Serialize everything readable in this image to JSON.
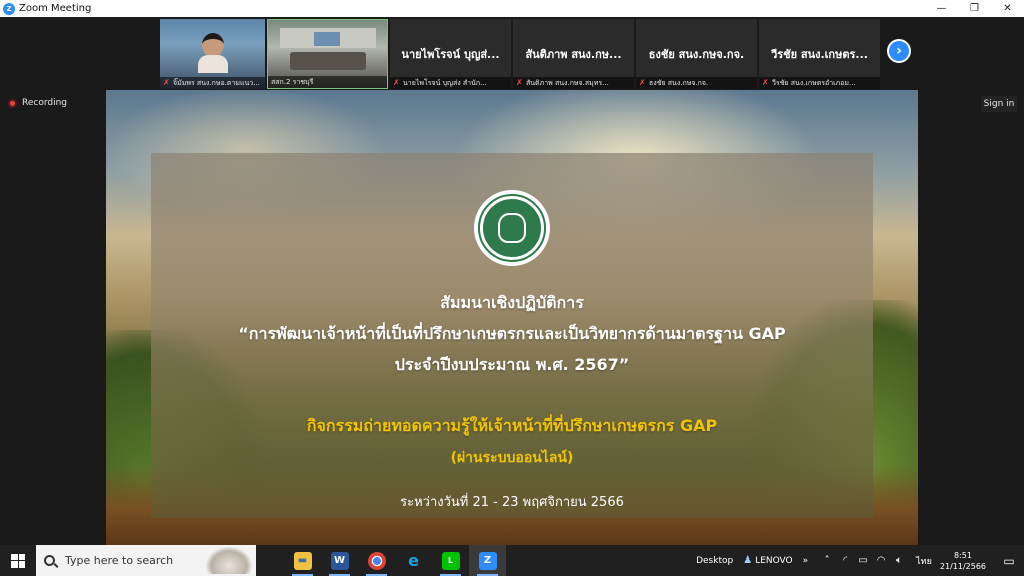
{
  "window": {
    "title": "Zoom Meeting",
    "controls": {
      "minimize": "—",
      "restore": "❐",
      "close": "✕"
    }
  },
  "participants": [
    {
      "big_name": "",
      "caption": "จิ๊มัมพร สนง.กษอ.ตามแนว..."
    },
    {
      "big_name": "",
      "caption": "สสก.2 ราชบุรี"
    },
    {
      "big_name": "นายไพโรจน์ บุญส่...",
      "caption": "นายไพโรจน์ บุญส่ง สำนัก..."
    },
    {
      "big_name": "สันติภาพ สนง.กษ...",
      "caption": "สันติภาพ สนง.กษจ.สมุทร..."
    },
    {
      "big_name": "ธงชัย สนง.กษจ.กจ.",
      "caption": "ธงชัย สนง.กษจ.กจ."
    },
    {
      "big_name": "วีรชัย สนง.เกษตร...",
      "caption": "วีรชัย สนง.เกษตรอำเภอม..."
    }
  ],
  "next_page_icon": "chevron-right",
  "recording_label": "Recording",
  "signin_label": "Sign in",
  "slide": {
    "line1": "สัมมนาเชิงปฏิบัติการ",
    "line2": "“การพัฒนาเจ้าหน้าที่เป็นที่ปรึกษาเกษตรกรและเป็นวิทยากรด้านมาตรฐาน GAP",
    "line3": "ประจำปีงบประมาณ พ.ศ. 2567”",
    "activity": "กิจกรรมถ่ายทอดความรู้ให้เจ้าหน้าที่ที่ปรึกษาเกษตรกร GAP",
    "mode": "(ผ่านระบบออนไลน์)",
    "dates": "ระหว่างวันที่ 21 - 23 พฤศจิกายน 2566",
    "accent_color": "#f2c400"
  },
  "taskbar": {
    "search_placeholder": "Type here to search",
    "apps": [
      {
        "name": "file-explorer",
        "glyph": "▬",
        "color": "#f0c040"
      },
      {
        "name": "word",
        "glyph": "W",
        "color": "#2b579a"
      },
      {
        "name": "chrome",
        "glyph": "●",
        "color": "#db4437"
      },
      {
        "name": "internet-explorer",
        "glyph": "e",
        "color": "#1ea0e6"
      },
      {
        "name": "line",
        "glyph": "L",
        "color": "#00c300"
      },
      {
        "name": "zoom",
        "glyph": "Z",
        "color": "#2d8cff"
      }
    ],
    "desktop_label": "Desktop",
    "user_label": "LENOVO",
    "language": "ไทย",
    "time": "8:51",
    "date": "21/11/2566"
  }
}
